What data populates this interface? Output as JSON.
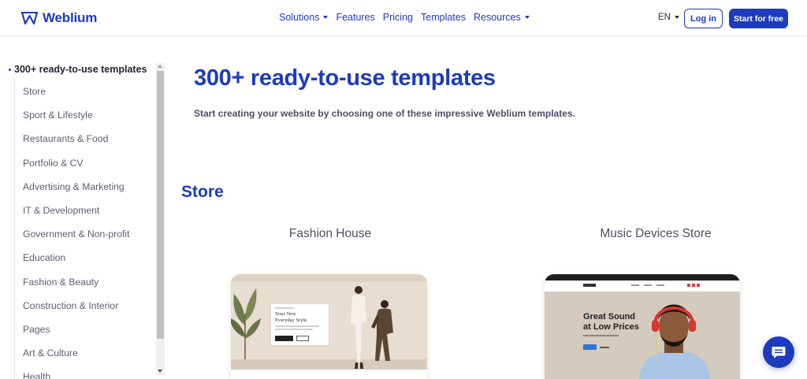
{
  "header": {
    "logo_text": "Weblium",
    "nav": [
      {
        "label": "Solutions",
        "has_caret": true
      },
      {
        "label": "Features",
        "has_caret": false
      },
      {
        "label": "Pricing",
        "has_caret": false
      },
      {
        "label": "Templates",
        "has_caret": false
      },
      {
        "label": "Resources",
        "has_caret": true
      }
    ],
    "language": "EN",
    "login_label": "Log in",
    "start_label": "Start for free"
  },
  "sidebar": {
    "heading": "300+ ready-to-use templates",
    "items": [
      {
        "label": "Store"
      },
      {
        "label": "Sport & Lifestyle"
      },
      {
        "label": "Restaurants & Food"
      },
      {
        "label": "Portfolio & CV"
      },
      {
        "label": "Advertising & Marketing"
      },
      {
        "label": "IT & Development"
      },
      {
        "label": "Government & Non-profit"
      },
      {
        "label": "Education"
      },
      {
        "label": "Fashion & Beauty"
      },
      {
        "label": "Construction & Interior"
      },
      {
        "label": "Pages"
      },
      {
        "label": "Art & Culture"
      },
      {
        "label": "Health"
      }
    ]
  },
  "main": {
    "title": "300+ ready-to-use templates",
    "subtitle": "Start creating your website by choosing one of these impressive Weblium templates.",
    "section_title": "Store",
    "cards": [
      {
        "title": "Fashion House",
        "preview_heading_1": "Your New",
        "preview_heading_2": "Everyday Style."
      },
      {
        "title": "Music Devices Store",
        "preview_heading_1": "Great Sound",
        "preview_heading_2": "at Low Prices"
      }
    ]
  },
  "colors": {
    "brand": "#1d3bbf",
    "text": "#1f2235",
    "muted": "#5a5e72"
  }
}
